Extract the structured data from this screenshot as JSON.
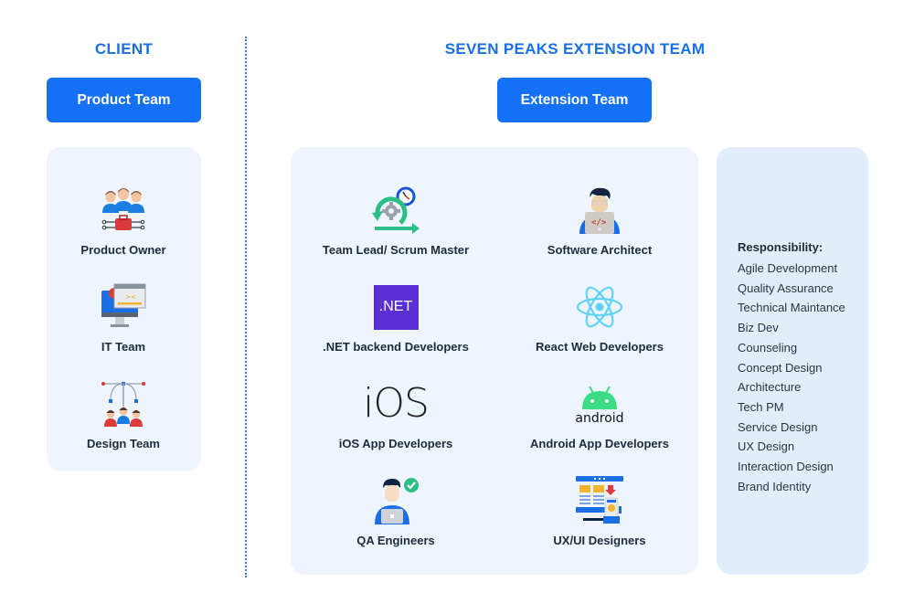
{
  "client": {
    "heading": "CLIENT",
    "button_label": "Product Team",
    "roles": [
      {
        "label": "Product Owner",
        "icon": "team-briefcase-icon"
      },
      {
        "label": "IT Team",
        "icon": "computer-code-icon"
      },
      {
        "label": "Design Team",
        "icon": "design-team-icon"
      }
    ]
  },
  "extension": {
    "heading": "SEVEN PEAKS EXTENSION TEAM",
    "button_label": "Extension Team",
    "roles": [
      {
        "label": "Team Lead/ Scrum Master",
        "icon": "scrum-cycle-icon"
      },
      {
        "label": "Software Architect",
        "icon": "developer-avatar-icon"
      },
      {
        "label": ".NET backend Developers",
        "icon": "dotnet-logo-icon",
        "logo_text": ".NET"
      },
      {
        "label": "React Web Developers",
        "icon": "react-logo-icon"
      },
      {
        "label": "iOS App Developers",
        "icon": "ios-logo-icon",
        "logo_text": "iOS"
      },
      {
        "label": "Android App Developers",
        "icon": "android-logo-icon",
        "logo_text": "android"
      },
      {
        "label": "QA Engineers",
        "icon": "qa-engineer-icon"
      },
      {
        "label": "UX/UI Designers",
        "icon": "ux-ui-design-icon"
      }
    ]
  },
  "responsibility": {
    "title": "Responsibility:",
    "items": [
      "Agile Development",
      "Quality Assurance",
      "Technical Maintance",
      "Biz Dev",
      "Counseling",
      "Concept Design",
      "Architecture",
      "Tech PM",
      "Service Design",
      "UX Design",
      "Interaction Design",
      "Brand Identity"
    ]
  },
  "colors": {
    "accent": "#1471f5",
    "heading": "#1a6fe6",
    "panel": "#eef5fe",
    "responsibility_panel": "#e1edfc",
    "dotnet": "#5b2fd6",
    "react": "#5ed3f3",
    "android": "#3ddc84"
  }
}
